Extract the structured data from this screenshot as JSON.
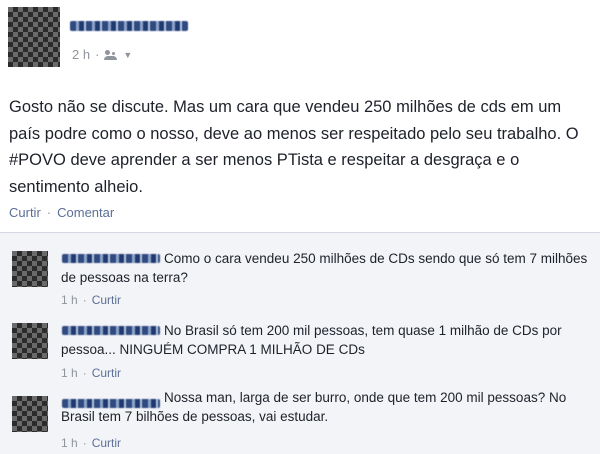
{
  "post": {
    "time": "2 h",
    "text": "Gosto não se discute. Mas um cara que vendeu 250 milhões de cds em um país podre como o nosso, deve ao menos ser respeitado pelo seu trabalho. O #POVO deve aprender a ser menos PTista e respeitar a desgraça e o sentimento alheio.",
    "actions": {
      "like": "Curtir",
      "separator": "·",
      "comment": "Comentar"
    }
  },
  "comments": [
    {
      "text": "Como o cara vendeu 250 milhões de CDs sendo que só tem 7 milhões de pessoas na terra?",
      "time": "1 h",
      "separator": "·",
      "like": "Curtir"
    },
    {
      "text": "No Brasil só tem 200 mil pessoas, tem quase 1 milhão de CDs por pessoa... NINGUÉM COMPRA 1 MILHÃO DE CDs",
      "time": "1 h",
      "separator": "·",
      "like": "Curtir"
    },
    {
      "text": "Nossa man, larga de ser burro, onde que tem 200 mil pessoas? No Brasil tem 7 bilhões de pessoas, vai estudar.",
      "time": "1 h",
      "separator": "·",
      "like": "Curtir"
    }
  ],
  "colors": {
    "link": "#5b6f96",
    "meta": "#90949c",
    "text": "#1d2129",
    "comments_bg": "#f3f4f8"
  },
  "icons": {
    "audience": "friends-icon",
    "dropdown": "chevron-down-icon"
  }
}
